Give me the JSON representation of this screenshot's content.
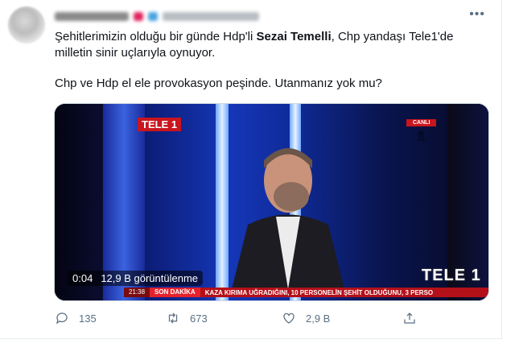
{
  "tweet": {
    "text_line1_before": "Şehitlerimizin olduğu bir günde Hdp'li ",
    "text_line1_bold": "Sezai Temelli",
    "text_line1_after": ", Chp yandaşı Tele1'de",
    "text_line2": "milletin sinir uçlarıyla oynuyor.",
    "text_line3": "Chp ve Hdp el ele provokasyon peşinde. Utanmanız yok mu?",
    "more_icon": "more-horizontal-icon"
  },
  "video": {
    "logo": "TELE 1",
    "live_badge": "CANLI",
    "logo_bottom": "TELE 1",
    "ticker_clock": "21:38",
    "ticker_tag": "SON DAKİKA",
    "ticker_text": "KAZA KIRIMA UĞRADIĞINI, 10 PERSONELİN ŞEHİT OLDUĞUNU, 3 PERSO",
    "time": "0:04",
    "views": "12,9 B görüntülenme"
  },
  "actions": {
    "reply_count": "135",
    "retweet_count": "673",
    "like_count": "2,9 B"
  },
  "colors": {
    "muted": "#5b7083",
    "tele1_red": "#c9151e"
  }
}
